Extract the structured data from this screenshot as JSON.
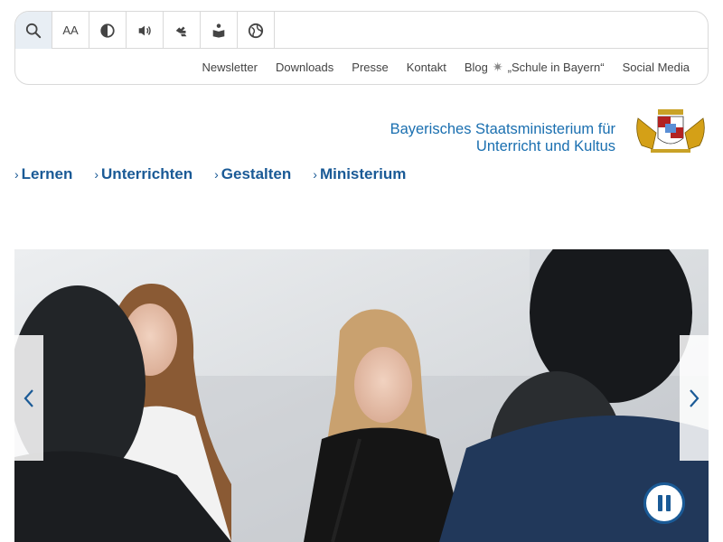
{
  "toolbar": {
    "tools": [
      {
        "name": "search-icon",
        "label": "Search"
      },
      {
        "name": "font-size-icon",
        "label": "AA"
      },
      {
        "name": "contrast-icon"
      },
      {
        "name": "speaker-icon"
      },
      {
        "name": "sign-language-icon"
      },
      {
        "name": "easy-language-icon"
      },
      {
        "name": "globe-icon"
      }
    ]
  },
  "metanav": {
    "items": [
      "Newsletter",
      "Downloads",
      "Presse",
      "Kontakt",
      "Blog",
      "„Schule in Bayern“",
      "Social Media"
    ]
  },
  "ministry": {
    "line1": "Bayerisches Staatsministerium für",
    "line2": "Unterricht und Kultus"
  },
  "mainnav": {
    "items": [
      "Lernen",
      "Unterrichten",
      "Gestalten",
      "Ministerium"
    ]
  },
  "colors": {
    "brand_blue": "#1a5a96",
    "ministry_blue": "#1a6fb0",
    "border": "#d9d9d9"
  }
}
